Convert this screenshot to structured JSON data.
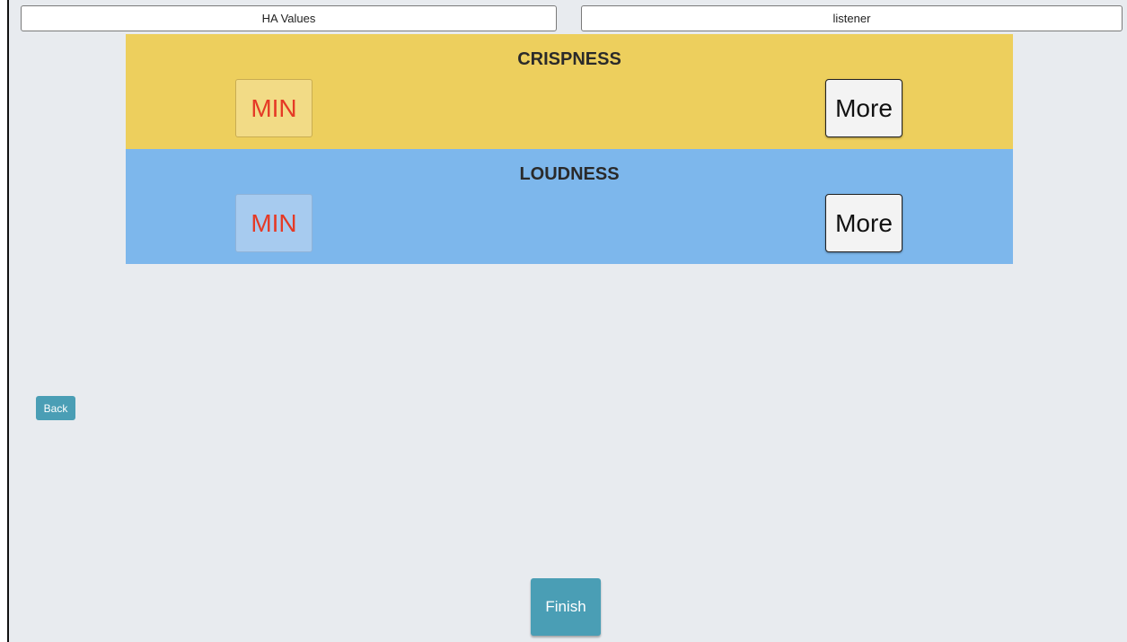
{
  "tabs": {
    "ha_values": "HA Values",
    "listener": "listener"
  },
  "panels": {
    "crispness": {
      "title": "CRISPNESS",
      "min_label": "MIN",
      "more_label": "More",
      "color": "#edcf5d"
    },
    "loudness": {
      "title": "LOUDNESS",
      "min_label": "MIN",
      "more_label": "More",
      "color": "#7db7ec"
    }
  },
  "nav": {
    "back_label": "Back",
    "finish_label": "Finish",
    "accent_color": "#4a9eb5"
  },
  "min_text_color": "#e53a26"
}
